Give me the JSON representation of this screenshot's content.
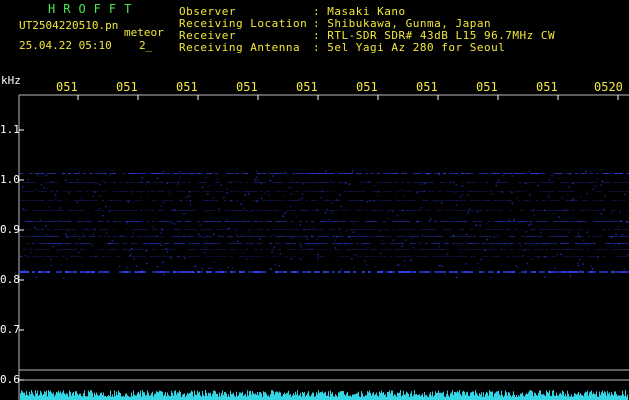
{
  "header": {
    "brand": "HROFFT",
    "filename": "UT2504220510.pn",
    "meteor_label": "meteor",
    "datetime": "25.04.22 05:10",
    "count": "2_"
  },
  "info": {
    "observer_label": "Observer",
    "observer_value": ": Masaki Kano",
    "location_label": "Receiving Location",
    "location_value": ": Shibukawa, Gunma, Japan",
    "receiver_label": "Receiver",
    "receiver_value": ": RTL-SDR SDR# 43dB L15 96.7MHz CW",
    "antenna_label": "Receiving Antenna",
    "antenna_value": ": 5el Yagi Az 280 for Seoul"
  },
  "axis": {
    "y_unit": "kHz",
    "y_ticks": [
      "1.1",
      "1.0",
      "0.9",
      "0.8",
      "0.7",
      "0.6"
    ],
    "x_ticks": [
      "051",
      "051",
      "051",
      "051",
      "051",
      "051",
      "051",
      "051",
      "051",
      "0520"
    ]
  },
  "colors": {
    "text_green": "#46e84f",
    "text_yellow": "#f4e93a",
    "signal_blue": "#3344ff",
    "noise_cyan": "#34d6e6"
  }
}
